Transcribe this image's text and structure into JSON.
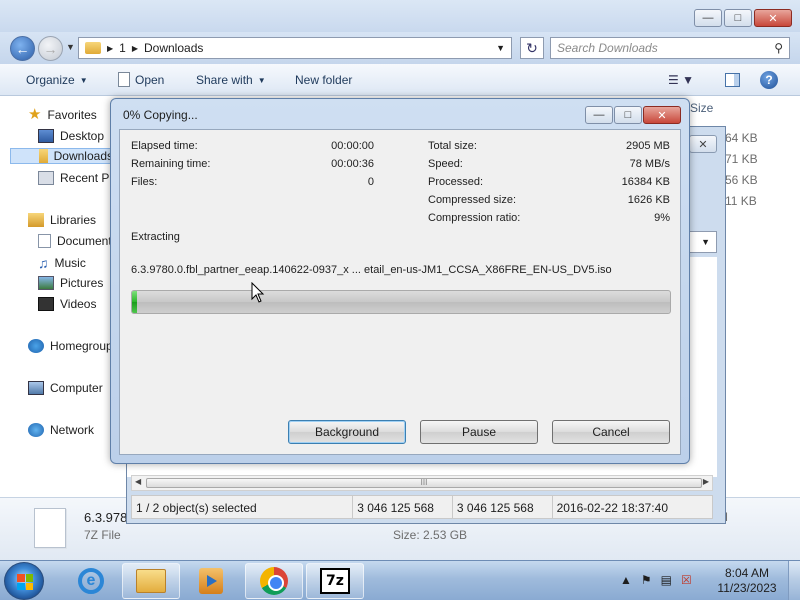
{
  "explorer": {
    "address": {
      "root": "1",
      "folder": "Downloads"
    },
    "search_placeholder": "Search Downloads",
    "toolbar": {
      "organize": "Organize",
      "open": "Open",
      "share_with": "Share with",
      "new_folder": "New folder"
    },
    "sidebar": {
      "favorites": "Favorites",
      "desktop": "Desktop",
      "downloads": "Downloads",
      "recent_places": "Recent Places",
      "libraries": "Libraries",
      "documents": "Documents",
      "music": "Music",
      "pictures": "Pictures",
      "videos": "Videos",
      "homegroup": "Homegroup",
      "computer": "Computer",
      "network": "Network"
    },
    "column_header": "Size",
    "sizes": [
      "64 KB",
      "71 KB",
      "56 KB",
      "11 KB"
    ],
    "details": {
      "name": "6.3.978",
      "type": "7Z File",
      "size": "Size: 2.53 GB",
      "modified_fragment": "M"
    }
  },
  "zip_window": {
    "status": {
      "selection": "1 / 2 object(s) selected",
      "size": "3 046 125 568",
      "packed": "3 046 125 568",
      "modified": "2016-02-22 18:37:40"
    },
    "scroll_grip": "III"
  },
  "dialog": {
    "title": "0% Copying...",
    "stats_left": [
      {
        "label": "Elapsed time:",
        "value": "00:00:00"
      },
      {
        "label": "Remaining time:",
        "value": "00:00:36"
      },
      {
        "label": "Files:",
        "value": "0"
      }
    ],
    "stats_right": [
      {
        "label": "Total size:",
        "value": "2905 MB"
      },
      {
        "label": "Speed:",
        "value": "78 MB/s"
      },
      {
        "label": "Processed:",
        "value": "16384 KB"
      },
      {
        "label": "Compressed size:",
        "value": "1626 KB"
      },
      {
        "label": "Compression ratio:",
        "value": "9%"
      }
    ],
    "operation": "Extracting",
    "current_file": "6.3.9780.0.fbl_partner_eeap.140622-0937_x ... etail_en-us-JM1_CCSA_X86FRE_EN-US_DV5.iso",
    "progress_percent": 1,
    "buttons": {
      "background": "Background",
      "pause": "Pause",
      "cancel": "Cancel"
    }
  },
  "taskbar": {
    "clock_time": "8:04 AM",
    "clock_date": "11/23/2023",
    "apps": [
      "internet-explorer",
      "windows-explorer",
      "windows-media-player",
      "google-chrome",
      "7-zip"
    ],
    "sevenzip_label": "7z",
    "ie_label": "e"
  },
  "colors": {
    "progress_fill": "#2bb52a",
    "selection": "#cfe3fa",
    "accent": "#3c7fb1"
  }
}
